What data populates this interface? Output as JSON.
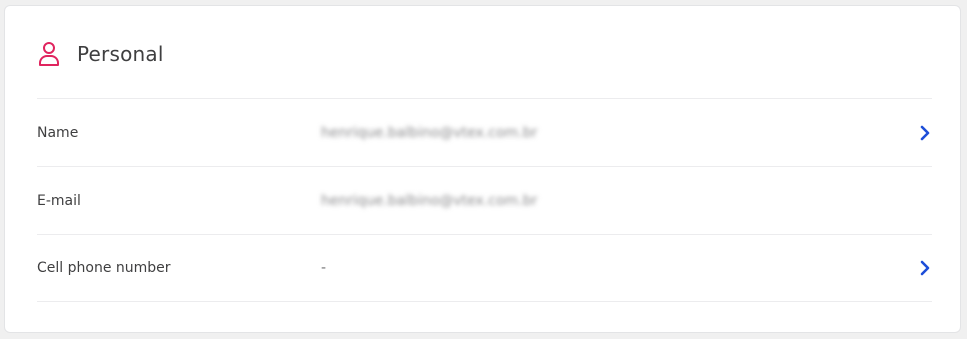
{
  "section": {
    "title": "Personal",
    "icon": "user-icon",
    "icon_color": "#e0245e"
  },
  "rows": [
    {
      "label": "Name",
      "value": "henrique.balbino@vtex.com.br",
      "has_chevron": true
    },
    {
      "label": "E-mail",
      "value": "henrique.balbino@vtex.com.br",
      "has_chevron": false
    },
    {
      "label": "Cell phone number",
      "value": "-",
      "has_chevron": true
    }
  ],
  "colors": {
    "accent": "#1d4ed8",
    "divider": "#ececee"
  }
}
